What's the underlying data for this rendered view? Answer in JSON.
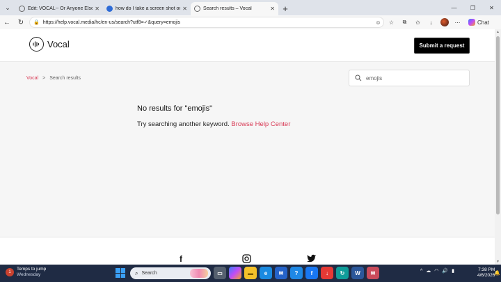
{
  "browser": {
    "tabs": [
      {
        "label": "Edit: VOCAL-- Or Anyone Else-- Pl",
        "icon": "vocal-favicon",
        "active": false,
        "color": "#6b6b6b"
      },
      {
        "label": "how do I take a screen shot on my",
        "icon": "search-favicon",
        "active": false,
        "color": "#2e6bd6"
      },
      {
        "label": "Search results – Vocal",
        "icon": "vocal-favicon",
        "active": true,
        "color": "#6b6b6b"
      }
    ],
    "url": "https://help.vocal.media/hc/en-us/search?utf8=✓&query=emojis",
    "chat_label": "Chat"
  },
  "header": {
    "logo_text": "Vocal",
    "submit_label": "Submit a request"
  },
  "breadcrumb": {
    "home": "Vocal",
    "separator": ">",
    "current": "Search results"
  },
  "search": {
    "value": "emojis"
  },
  "results": {
    "title": "No results for \"emojis\"",
    "hint": "Try searching another keyword.",
    "link": "Browse Help Center"
  },
  "taskbar": {
    "weather_title": "Temps to jump",
    "weather_sub": "Wednesday",
    "weather_badge": "1",
    "search_label": "Search",
    "time": "7:38 PM",
    "date": "4/6/2026"
  },
  "colors": {
    "accent": "#d83a55",
    "button": "#000000",
    "taskbar": "#1f2b44"
  }
}
